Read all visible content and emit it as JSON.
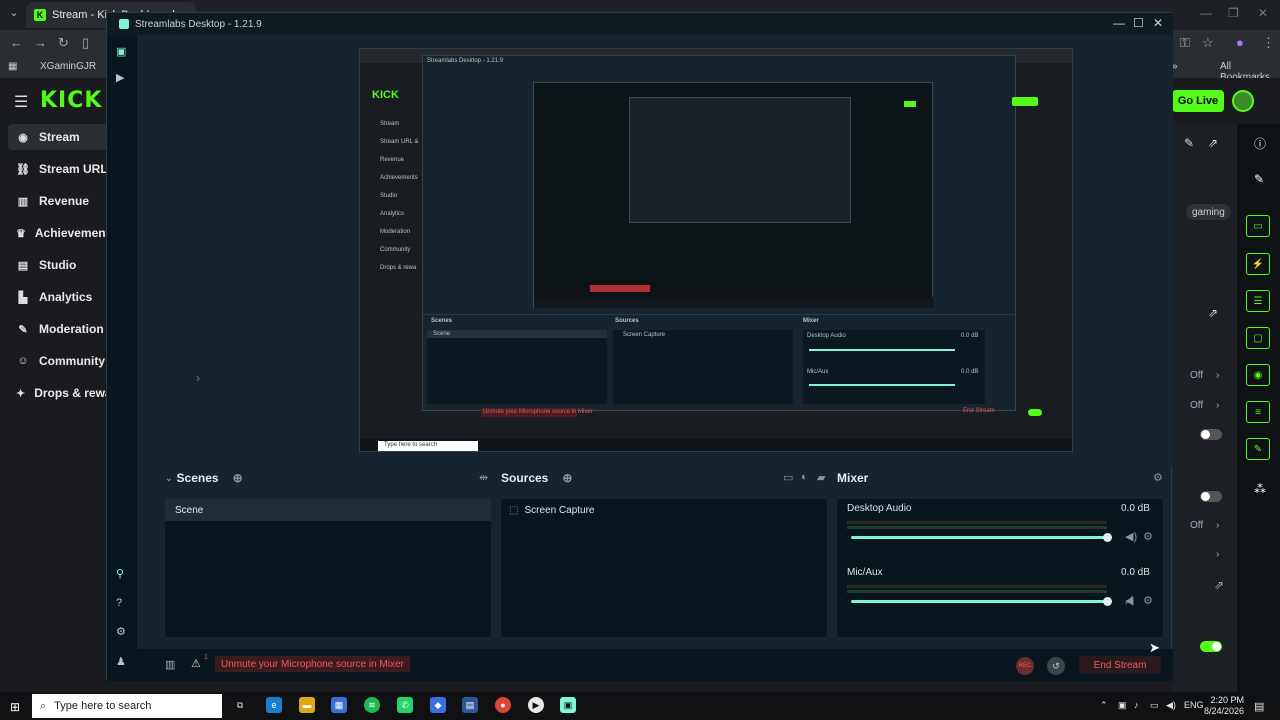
{
  "browser": {
    "tab_title": "Stream - Kick Dashboard",
    "bookmark_1": "XGaminGJR",
    "bookmark_all": "All Bookmarks",
    "kick_logo": "KICK",
    "go_live": "Go Live",
    "gaming_tag": "gaming"
  },
  "kick_sidebar": {
    "items": [
      {
        "label": "Stream",
        "icon": "broadcast-icon"
      },
      {
        "label": "Stream URL & Key",
        "icon": "link-icon"
      },
      {
        "label": "Revenue",
        "icon": "revenue-icon"
      },
      {
        "label": "Achievements",
        "icon": "trophy-icon"
      },
      {
        "label": "Studio",
        "icon": "studio-icon"
      },
      {
        "label": "Analytics",
        "icon": "analytics-icon"
      },
      {
        "label": "Moderation",
        "icon": "wrench-icon"
      },
      {
        "label": "Community",
        "icon": "community-icon"
      },
      {
        "label": "Drops & rewards",
        "icon": "gift-icon"
      }
    ]
  },
  "kick_right": {
    "off_1": "Off",
    "off_2": "Off",
    "off_3": "Off"
  },
  "streamlabs": {
    "title": "Streamlabs Desktop - 1.21.9",
    "scenes_header": "Scenes",
    "sources_header": "Sources",
    "mixer_header": "Mixer",
    "scenes": [
      "Scene"
    ],
    "sources": [
      "Screen Capture"
    ],
    "mixer": [
      {
        "name": "Desktop Audio",
        "db": "0.0 dB",
        "level": 1.0
      },
      {
        "name": "Mic/Aux",
        "db": "0.0 dB",
        "level": 1.0
      }
    ],
    "footer_alert_count": "1",
    "footer_warning": "Unmute your Microphone source in Mixer",
    "rec_label": "REC",
    "end_stream": "End Stream",
    "accent": "#80f5d2"
  },
  "preview_nested": {
    "title": "Streamlabs Desktop - 1.21.9",
    "scenes": "Scenes",
    "sources": "Sources",
    "mixer": "Mixer",
    "scene": "Scene",
    "source": "Screen Capture",
    "desktop_audio": "Desktop Audio",
    "mic_aux": "Mic/Aux",
    "db": "0.0 dB",
    "warning": "Unmute your Microphone source in Mixer",
    "end_stream": "End Stream",
    "search": "Type here to search",
    "sidebar": [
      "Stream",
      "Stream URL &",
      "Revenue",
      "Achievements",
      "Studio",
      "Analytics",
      "Moderation",
      "Community",
      "Drops & rewa"
    ]
  },
  "taskbar": {
    "search_placeholder": "Type here to search",
    "lang": "ENG",
    "time": "2:20 PM",
    "date": "8/24/2026"
  },
  "colors": {
    "kick_green": "#53fc18",
    "streamlabs_teal": "#80f5d2",
    "warning_red": "#ef5a5a"
  }
}
